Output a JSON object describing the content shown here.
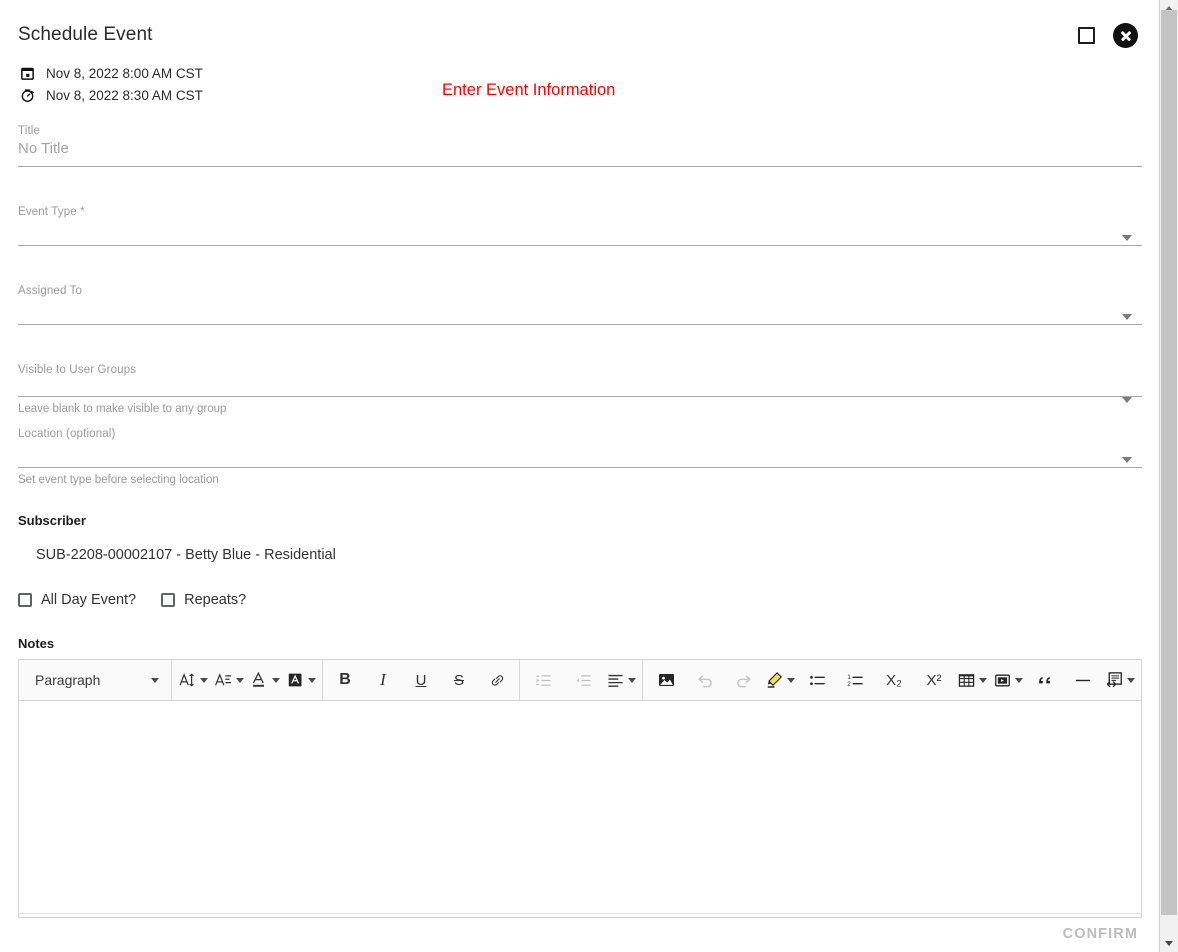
{
  "dialog": {
    "title": "Schedule Event",
    "maximize_icon": "square-icon",
    "close_icon": "close-circle-icon"
  },
  "datetime": {
    "start_icon": "calendar-icon",
    "start": "Nov 8, 2022 8:00 AM CST",
    "end_icon": "timer-icon",
    "end": "Nov 8, 2022 8:30 AM CST"
  },
  "banner": {
    "text": "Enter Event Information",
    "color": "#ff0000"
  },
  "fields": {
    "title": {
      "label": "Title",
      "value": "No Title",
      "placeholder": "No Title"
    },
    "event_type": {
      "label": "Event Type *",
      "value": "",
      "caret_icon": "chevron-down-icon"
    },
    "assigned_to": {
      "label": "Assigned To",
      "value": "",
      "caret_icon": "chevron-down-icon"
    },
    "visible_groups": {
      "label": "Visible to User Groups",
      "value": "",
      "helper": "Leave blank to make visible to any group",
      "caret_icon": "chevron-down-icon"
    },
    "location": {
      "label": "Location (optional)",
      "value": "",
      "helper": "Set event type before selecting location",
      "caret_icon": "chevron-down-icon"
    }
  },
  "subscriber": {
    "heading": "Subscriber",
    "value": "SUB-2208-00002107 - Betty Blue - Residential"
  },
  "checkboxes": [
    {
      "label": "All Day Event?",
      "checked": false
    },
    {
      "label": "Repeats?",
      "checked": false
    }
  ],
  "notes": {
    "heading": "Notes",
    "body": "",
    "toolbar": {
      "paragraph_style": "Paragraph",
      "buttons": [
        {
          "name": "font-size-icon",
          "glyph": "AI",
          "dim": false,
          "chevron": true
        },
        {
          "name": "font-family-icon",
          "glyph": "A",
          "dim": false,
          "chevron": true
        },
        {
          "name": "text-color-icon",
          "glyph": "A",
          "dim": false,
          "chevron": true
        },
        {
          "name": "background-color-icon",
          "glyph": "A",
          "dim": false,
          "chevron": true
        },
        {
          "name": "bold-icon",
          "glyph": "B",
          "dim": false,
          "chevron": false
        },
        {
          "name": "italic-icon",
          "glyph": "I",
          "dim": false,
          "chevron": false
        },
        {
          "name": "underline-icon",
          "glyph": "U",
          "dim": false,
          "chevron": false
        },
        {
          "name": "strikethrough-icon",
          "glyph": "S",
          "dim": false,
          "chevron": false
        },
        {
          "name": "link-icon",
          "glyph": "&",
          "dim": false,
          "chevron": false
        },
        {
          "name": "indent-icon",
          "glyph": "",
          "dim": true,
          "chevron": false
        },
        {
          "name": "outdent-icon",
          "glyph": "",
          "dim": true,
          "chevron": false
        },
        {
          "name": "align-icon",
          "glyph": "",
          "dim": false,
          "chevron": true
        },
        {
          "name": "image-icon",
          "glyph": "",
          "dim": false,
          "chevron": false
        },
        {
          "name": "undo-icon",
          "glyph": "",
          "dim": true,
          "chevron": false
        },
        {
          "name": "redo-icon",
          "glyph": "",
          "dim": true,
          "chevron": false
        },
        {
          "name": "highlighter-icon",
          "glyph": "",
          "dim": false,
          "chevron": true
        },
        {
          "name": "bulleted-list-icon",
          "glyph": "",
          "dim": false,
          "chevron": false
        },
        {
          "name": "numbered-list-icon",
          "glyph": "",
          "dim": false,
          "chevron": false
        },
        {
          "name": "subscript-icon",
          "glyph": "X₂",
          "dim": false,
          "chevron": false
        },
        {
          "name": "superscript-icon",
          "glyph": "X²",
          "dim": false,
          "chevron": false
        },
        {
          "name": "table-icon",
          "glyph": "",
          "dim": false,
          "chevron": true
        },
        {
          "name": "media-icon",
          "glyph": "",
          "dim": false,
          "chevron": true
        },
        {
          "name": "blockquote-icon",
          "glyph": "“",
          "dim": false,
          "chevron": false
        },
        {
          "name": "horizontal-rule-icon",
          "glyph": "—",
          "dim": false,
          "chevron": false
        },
        {
          "name": "source-code-icon",
          "glyph": "",
          "dim": false,
          "chevron": true
        }
      ]
    }
  },
  "footer": {
    "confirm_label": "CONFIRM",
    "confirm_enabled": false
  },
  "scrollbar": {
    "up_arrow_icon": "chevron-up-icon",
    "down_arrow_icon": "chevron-down-icon"
  }
}
